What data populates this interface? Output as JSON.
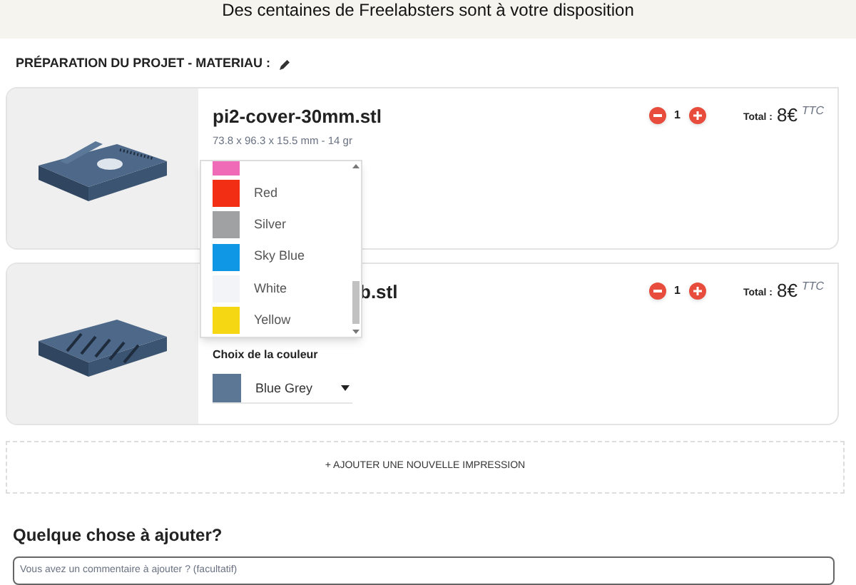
{
  "banner": {
    "headline": "Des centaines de Freelabsters sont à votre disposition"
  },
  "section": {
    "title": "PRÉPARATION DU PROJET - MATERIAU :"
  },
  "items": [
    {
      "name": "pi2-cover-30mm.stl",
      "dimensions": "73.8 x 96.3 x 15.5 mm - 14 gr",
      "quantity": "1",
      "total_label": "Total :",
      "price": "8€",
      "tax": "TTC"
    },
    {
      "name": "b.stl",
      "quantity": "1",
      "total_label": "Total :",
      "price": "8€",
      "tax": "TTC",
      "color_label": "Choix de la couleur",
      "color": {
        "label": "Blue Grey",
        "color": "#5b7795"
      }
    }
  ],
  "color_dropdown": {
    "options": [
      {
        "color": "#f06bb7"
      },
      {
        "label": "Red",
        "color": "#f22f14"
      },
      {
        "label": "Silver",
        "color": "#9fa1a3"
      },
      {
        "label": "Sky Blue",
        "color": "#0f97e6"
      },
      {
        "label": "White",
        "color": "#f2f4f7"
      },
      {
        "label": "Yellow",
        "color": "#f5d714"
      }
    ]
  },
  "add_button": "+ AJOUTER UNE NOUVELLE IMPRESSION",
  "comment": {
    "title": "Quelque chose à ajouter?",
    "placeholder": "Vous avez un commentaire à ajouter ? (facultatif)"
  }
}
